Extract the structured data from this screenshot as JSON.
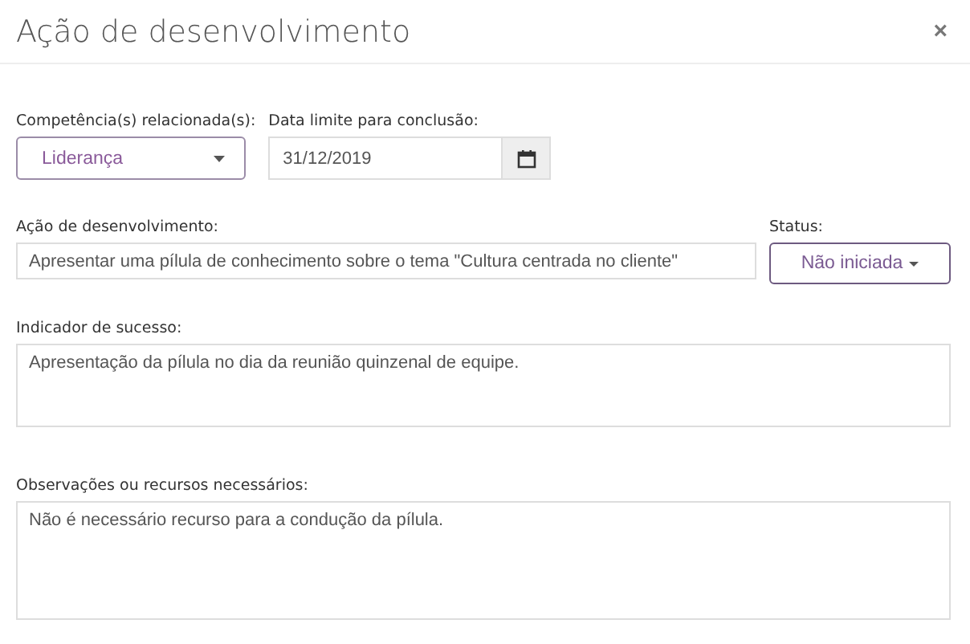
{
  "dialog": {
    "title": "Ação de desenvolvimento",
    "close": "×"
  },
  "competencia": {
    "label": "Competência(s) relacionada(s):",
    "value": "Liderança"
  },
  "data_limite": {
    "label": "Data limite para conclusão:",
    "value": "31/12/2019"
  },
  "acao": {
    "label": "Ação de desenvolvimento:",
    "value": "Apresentar uma pílula de conhecimento sobre o tema \"Cultura centrada no cliente\""
  },
  "status": {
    "label": "Status:",
    "value": "Não iniciada"
  },
  "indicador": {
    "label": "Indicador de sucesso:",
    "value": "Apresentação da pílula no dia da reunião quinzenal de equipe."
  },
  "observacoes": {
    "label": "Observações ou recursos necessários:",
    "value": "Não é necessário recurso para a condução da pílula."
  }
}
